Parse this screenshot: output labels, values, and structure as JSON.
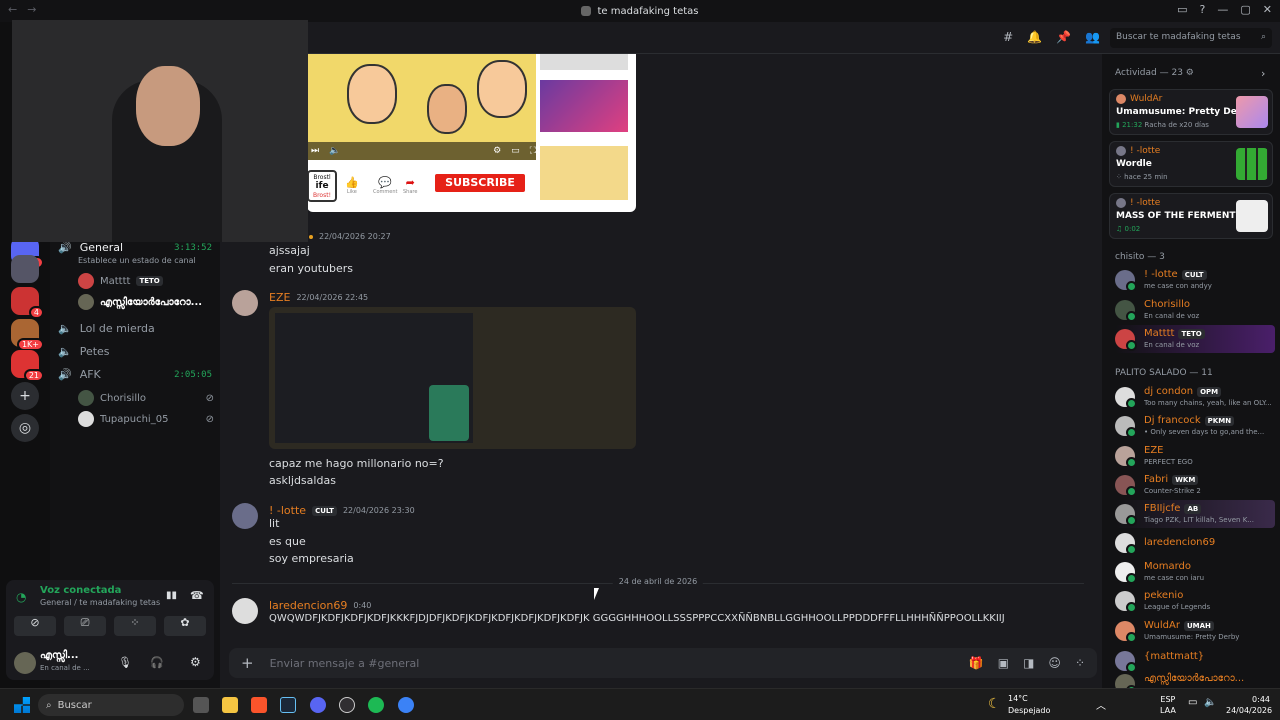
{
  "window": {
    "title": "te madafaking tetas"
  },
  "search": {
    "placeholder": "Buscar te madafaking tetas"
  },
  "servers": {
    "badges": [
      "99",
      "4",
      "1K+",
      "21"
    ]
  },
  "channels": {
    "general": {
      "name": "General",
      "time": "3:13:52",
      "status": "Establece un estado de canal"
    },
    "general_users": [
      {
        "name": "Matttt",
        "tag": "TETO"
      },
      {
        "name": "എസ്സിയോർപോറോ..."
      }
    ],
    "lol": "Lol de mierda",
    "petes": "Petes",
    "afk": {
      "name": "AFK",
      "time": "2:05:05"
    },
    "afk_users": [
      "Chorisillo",
      "Tupapuchi_05"
    ]
  },
  "voice": {
    "title": "Voz conectada",
    "sub": "General / te madafaking tetas",
    "user_name": "എസ്സി...",
    "user_status": "En canal de ..."
  },
  "embed": {
    "subscribe": "SUBSCRIBE",
    "like": "Like",
    "comment": "Comment",
    "share": "Share",
    "logo_line1": "Brostl",
    "logo_line2": "ife",
    "logo_line3": "Brost!"
  },
  "messages": [
    {
      "ts": "22/04/2026 20:27",
      "lines": [
        "ajssajaj",
        "eran youtubers"
      ]
    },
    {
      "author": "EZE",
      "ts": "22/04/2026 22:45",
      "lines": [
        "capaz me hago millonario no=?",
        "askljdsaldas"
      ]
    },
    {
      "author": "! -lotte",
      "tag": "CULT",
      "ts": "22/04/2026 23:30",
      "lines": [
        "lit",
        "es que",
        "soy empresaria"
      ]
    },
    {
      "author": "laredencion69",
      "ts": "0:40",
      "lines": [
        "QWQWDFJKDFJKDFJKDFJKKKFJDJDFJKDFJKDFJKDFJKDFJKDFJKDFJK   GGGGHHHOOLLSSSPPPCCXXÑÑBNBLLGGHHOOLLPPDDDFFFLLHHHÑÑPPOOLLKKIIJ"
      ]
    }
  ],
  "divider": "24 de abril de 2026",
  "composer": {
    "placeholder": "Enviar mensaje a #general"
  },
  "activity": {
    "header": "Actividad — 23",
    "cards": [
      {
        "name": "WuldAr",
        "game": "Umamusume: Pretty Derby",
        "time": "21:32",
        "detail": "Racha de x20 días"
      },
      {
        "name": "! -lotte",
        "game": "Wordle",
        "detail": "hace 25 min"
      },
      {
        "name": "! -lotte",
        "game": "MASS OF THE FERMENTI...",
        "time": "0:02"
      }
    ]
  },
  "sections": [
    {
      "title": "chisito — 3",
      "members": [
        {
          "name": "! -lotte",
          "tag": "CULT",
          "status": "me case con andyy"
        },
        {
          "name": "Chorisillo",
          "status": "En canal de voz"
        },
        {
          "name": "Matttt",
          "tag": "TETO",
          "status": "En canal de voz"
        }
      ]
    },
    {
      "title": "PALITO SALADO — 11",
      "members": [
        {
          "name": "dj condon",
          "tag": "OPM",
          "status": "Too many chains, yeah, like an OLY..."
        },
        {
          "name": "Dj francock",
          "tag": "PKMN",
          "status": "• Only seven days to go,and the..."
        },
        {
          "name": "EZE",
          "status": "PERFECT EGO"
        },
        {
          "name": "Fabri",
          "tag": "WKM",
          "status": "Counter-Strike 2"
        },
        {
          "name": "FBIIjcfe",
          "tag": "AB",
          "status": "Tiago PZK, LIT killah, Seven K..."
        },
        {
          "name": "laredencion69",
          "status": ""
        },
        {
          "name": "Momardo",
          "status": "me case con iaru"
        },
        {
          "name": "pekenio",
          "status": "League of Legends"
        },
        {
          "name": "WuldAr",
          "tag": "UMAH",
          "status": "Umamusume: Pretty Derby"
        },
        {
          "name": "{mattmatt}",
          "status": ""
        },
        {
          "name": "എസ്സിയോർപോറോ...",
          "status": ""
        }
      ]
    }
  ],
  "taskbar": {
    "search": "Buscar",
    "temp": "14°C",
    "weather": "Despejado",
    "lang1": "ESP",
    "lang2": "LAA",
    "time": "0:44",
    "date": "24/04/2026"
  }
}
